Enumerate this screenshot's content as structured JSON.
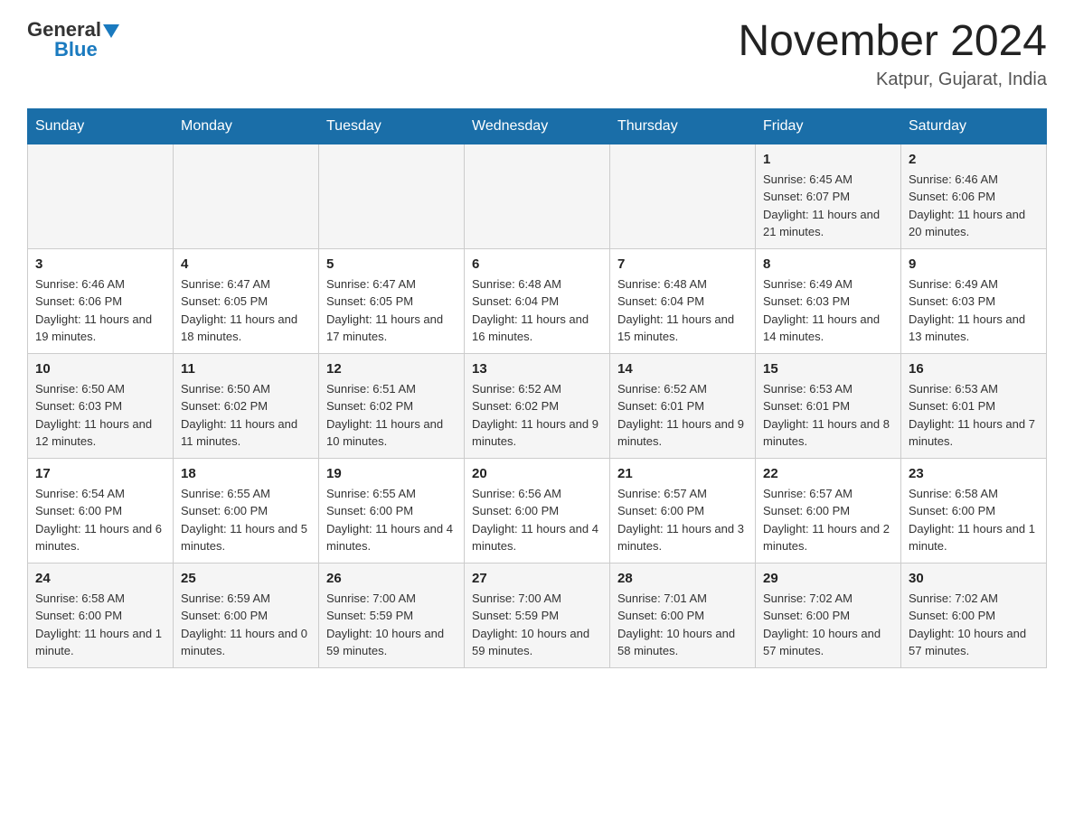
{
  "header": {
    "logo_general": "General",
    "logo_blue": "Blue",
    "month_title": "November 2024",
    "location": "Katpur, Gujarat, India"
  },
  "weekdays": [
    "Sunday",
    "Monday",
    "Tuesday",
    "Wednesday",
    "Thursday",
    "Friday",
    "Saturday"
  ],
  "weeks": [
    [
      {
        "day": "",
        "sunrise": "",
        "sunset": "",
        "daylight": ""
      },
      {
        "day": "",
        "sunrise": "",
        "sunset": "",
        "daylight": ""
      },
      {
        "day": "",
        "sunrise": "",
        "sunset": "",
        "daylight": ""
      },
      {
        "day": "",
        "sunrise": "",
        "sunset": "",
        "daylight": ""
      },
      {
        "day": "",
        "sunrise": "",
        "sunset": "",
        "daylight": ""
      },
      {
        "day": "1",
        "sunrise": "Sunrise: 6:45 AM",
        "sunset": "Sunset: 6:07 PM",
        "daylight": "Daylight: 11 hours and 21 minutes."
      },
      {
        "day": "2",
        "sunrise": "Sunrise: 6:46 AM",
        "sunset": "Sunset: 6:06 PM",
        "daylight": "Daylight: 11 hours and 20 minutes."
      }
    ],
    [
      {
        "day": "3",
        "sunrise": "Sunrise: 6:46 AM",
        "sunset": "Sunset: 6:06 PM",
        "daylight": "Daylight: 11 hours and 19 minutes."
      },
      {
        "day": "4",
        "sunrise": "Sunrise: 6:47 AM",
        "sunset": "Sunset: 6:05 PM",
        "daylight": "Daylight: 11 hours and 18 minutes."
      },
      {
        "day": "5",
        "sunrise": "Sunrise: 6:47 AM",
        "sunset": "Sunset: 6:05 PM",
        "daylight": "Daylight: 11 hours and 17 minutes."
      },
      {
        "day": "6",
        "sunrise": "Sunrise: 6:48 AM",
        "sunset": "Sunset: 6:04 PM",
        "daylight": "Daylight: 11 hours and 16 minutes."
      },
      {
        "day": "7",
        "sunrise": "Sunrise: 6:48 AM",
        "sunset": "Sunset: 6:04 PM",
        "daylight": "Daylight: 11 hours and 15 minutes."
      },
      {
        "day": "8",
        "sunrise": "Sunrise: 6:49 AM",
        "sunset": "Sunset: 6:03 PM",
        "daylight": "Daylight: 11 hours and 14 minutes."
      },
      {
        "day": "9",
        "sunrise": "Sunrise: 6:49 AM",
        "sunset": "Sunset: 6:03 PM",
        "daylight": "Daylight: 11 hours and 13 minutes."
      }
    ],
    [
      {
        "day": "10",
        "sunrise": "Sunrise: 6:50 AM",
        "sunset": "Sunset: 6:03 PM",
        "daylight": "Daylight: 11 hours and 12 minutes."
      },
      {
        "day": "11",
        "sunrise": "Sunrise: 6:50 AM",
        "sunset": "Sunset: 6:02 PM",
        "daylight": "Daylight: 11 hours and 11 minutes."
      },
      {
        "day": "12",
        "sunrise": "Sunrise: 6:51 AM",
        "sunset": "Sunset: 6:02 PM",
        "daylight": "Daylight: 11 hours and 10 minutes."
      },
      {
        "day": "13",
        "sunrise": "Sunrise: 6:52 AM",
        "sunset": "Sunset: 6:02 PM",
        "daylight": "Daylight: 11 hours and 9 minutes."
      },
      {
        "day": "14",
        "sunrise": "Sunrise: 6:52 AM",
        "sunset": "Sunset: 6:01 PM",
        "daylight": "Daylight: 11 hours and 9 minutes."
      },
      {
        "day": "15",
        "sunrise": "Sunrise: 6:53 AM",
        "sunset": "Sunset: 6:01 PM",
        "daylight": "Daylight: 11 hours and 8 minutes."
      },
      {
        "day": "16",
        "sunrise": "Sunrise: 6:53 AM",
        "sunset": "Sunset: 6:01 PM",
        "daylight": "Daylight: 11 hours and 7 minutes."
      }
    ],
    [
      {
        "day": "17",
        "sunrise": "Sunrise: 6:54 AM",
        "sunset": "Sunset: 6:00 PM",
        "daylight": "Daylight: 11 hours and 6 minutes."
      },
      {
        "day": "18",
        "sunrise": "Sunrise: 6:55 AM",
        "sunset": "Sunset: 6:00 PM",
        "daylight": "Daylight: 11 hours and 5 minutes."
      },
      {
        "day": "19",
        "sunrise": "Sunrise: 6:55 AM",
        "sunset": "Sunset: 6:00 PM",
        "daylight": "Daylight: 11 hours and 4 minutes."
      },
      {
        "day": "20",
        "sunrise": "Sunrise: 6:56 AM",
        "sunset": "Sunset: 6:00 PM",
        "daylight": "Daylight: 11 hours and 4 minutes."
      },
      {
        "day": "21",
        "sunrise": "Sunrise: 6:57 AM",
        "sunset": "Sunset: 6:00 PM",
        "daylight": "Daylight: 11 hours and 3 minutes."
      },
      {
        "day": "22",
        "sunrise": "Sunrise: 6:57 AM",
        "sunset": "Sunset: 6:00 PM",
        "daylight": "Daylight: 11 hours and 2 minutes."
      },
      {
        "day": "23",
        "sunrise": "Sunrise: 6:58 AM",
        "sunset": "Sunset: 6:00 PM",
        "daylight": "Daylight: 11 hours and 1 minute."
      }
    ],
    [
      {
        "day": "24",
        "sunrise": "Sunrise: 6:58 AM",
        "sunset": "Sunset: 6:00 PM",
        "daylight": "Daylight: 11 hours and 1 minute."
      },
      {
        "day": "25",
        "sunrise": "Sunrise: 6:59 AM",
        "sunset": "Sunset: 6:00 PM",
        "daylight": "Daylight: 11 hours and 0 minutes."
      },
      {
        "day": "26",
        "sunrise": "Sunrise: 7:00 AM",
        "sunset": "Sunset: 5:59 PM",
        "daylight": "Daylight: 10 hours and 59 minutes."
      },
      {
        "day": "27",
        "sunrise": "Sunrise: 7:00 AM",
        "sunset": "Sunset: 5:59 PM",
        "daylight": "Daylight: 10 hours and 59 minutes."
      },
      {
        "day": "28",
        "sunrise": "Sunrise: 7:01 AM",
        "sunset": "Sunset: 6:00 PM",
        "daylight": "Daylight: 10 hours and 58 minutes."
      },
      {
        "day": "29",
        "sunrise": "Sunrise: 7:02 AM",
        "sunset": "Sunset: 6:00 PM",
        "daylight": "Daylight: 10 hours and 57 minutes."
      },
      {
        "day": "30",
        "sunrise": "Sunrise: 7:02 AM",
        "sunset": "Sunset: 6:00 PM",
        "daylight": "Daylight: 10 hours and 57 minutes."
      }
    ]
  ]
}
